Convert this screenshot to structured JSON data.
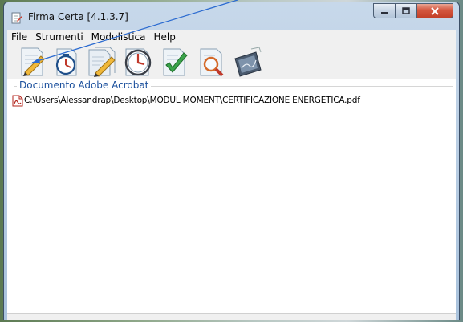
{
  "window": {
    "title": "Firma Certa [4.1.3.7]"
  },
  "menu": [
    "File",
    "Strumenti",
    "Modulistica",
    "Help"
  ],
  "toolbar": {
    "buttons": [
      {
        "icon": "sign-document-pen-icon"
      },
      {
        "icon": "timestamp-clock-icon"
      },
      {
        "icon": "sign-document-pen-icon"
      },
      {
        "icon": "timestamp-clock-icon"
      },
      {
        "icon": "verify-checkmark-icon"
      },
      {
        "icon": "view-magnifier-icon"
      },
      {
        "icon": "signature-pad-icon"
      }
    ]
  },
  "file_list": {
    "group_label": "Documento Adobe Acrobat",
    "files": [
      {
        "path": "C:\\Users\\Alessandrap\\Desktop\\MODUL MOMENT\\CERTIFICAZIONE ENERGETICA.pdf",
        "icon": "pdf-file-icon"
      }
    ]
  },
  "colors": {
    "accent_blue": "#1a4f9c",
    "close_red": "#c33f27"
  }
}
